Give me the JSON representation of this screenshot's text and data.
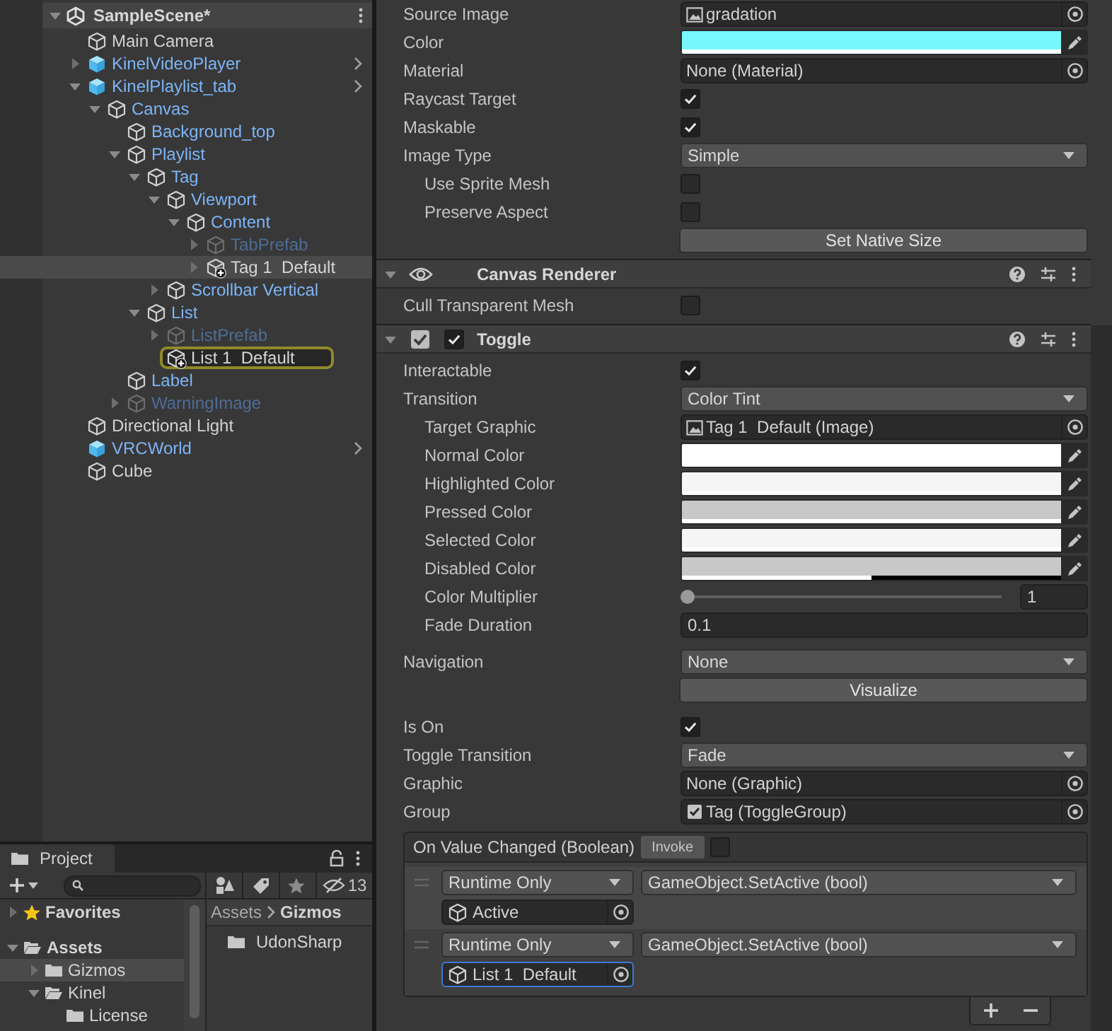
{
  "hierarchy": {
    "tree": [
      {
        "label": "SampleScene*",
        "kind": "scene",
        "expanded": true,
        "children": [
          {
            "label": "Main Camera",
            "kind": "object",
            "selected": false,
            "pinged": false
          },
          {
            "label": "KinelVideoPlayer",
            "kind": "prefab_root",
            "expanded": false,
            "selected": false,
            "pinged": false
          },
          {
            "label": "KinelPlaylist_tab",
            "kind": "prefab_root",
            "expanded": true,
            "selected": false,
            "pinged": false,
            "children": [
              {
                "label": "Canvas",
                "kind": "prefab_child",
                "expanded": true,
                "selected": false,
                "pinged": false,
                "children": [
                  {
                    "label": "Background_top",
                    "kind": "prefab_child",
                    "selected": false,
                    "pinged": false
                  },
                  {
                    "label": "Playlist",
                    "kind": "prefab_child",
                    "expanded": true,
                    "selected": false,
                    "pinged": false,
                    "children": [
                      {
                        "label": "Tag",
                        "kind": "prefab_child",
                        "expanded": true,
                        "selected": false,
                        "pinged": false,
                        "children": [
                          {
                            "label": "Viewport",
                            "kind": "prefab_child",
                            "expanded": true,
                            "selected": false,
                            "pinged": false,
                            "children": [
                              {
                                "label": "Content",
                                "kind": "prefab_child",
                                "expanded": true,
                                "selected": false,
                                "pinged": false,
                                "children": [
                                  {
                                    "label": "TabPrefab",
                                    "kind": "inactive",
                                    "expanded": false,
                                    "selected": false,
                                    "pinged": false
                                  },
                                  {
                                    "label": "Tag 1  Default",
                                    "kind": "added",
                                    "expanded": false,
                                    "selected": true,
                                    "pinged": false
                                  }
                                ]
                              }
                            ]
                          },
                          {
                            "label": "Scrollbar Vertical",
                            "kind": "prefab_child",
                            "expanded": false,
                            "selected": false,
                            "pinged": false
                          }
                        ]
                      },
                      {
                        "label": "List",
                        "kind": "prefab_child",
                        "expanded": true,
                        "selected": false,
                        "pinged": false,
                        "children": [
                          {
                            "label": "ListPrefab",
                            "kind": "inactive",
                            "expanded": false,
                            "selected": false,
                            "pinged": false
                          },
                          {
                            "label": "List 1  Default",
                            "kind": "added",
                            "selected": false,
                            "pinged": true
                          }
                        ]
                      }
                    ]
                  },
                  {
                    "label": "Label",
                    "kind": "prefab_child",
                    "selected": false,
                    "pinged": false
                  },
                  {
                    "label": "WarningImage",
                    "kind": "inactive",
                    "expanded": false,
                    "selected": false,
                    "pinged": false
                  }
                ]
              }
            ]
          },
          {
            "label": "Directional Light",
            "kind": "object",
            "selected": false,
            "pinged": false
          },
          {
            "label": "VRCWorld",
            "kind": "prefab_root",
            "selected": false,
            "pinged": false
          },
          {
            "label": "Cube",
            "kind": "object",
            "selected": false,
            "pinged": false
          }
        ]
      }
    ]
  },
  "project": {
    "tab": "Project",
    "hidden_count": "13",
    "tree": [
      {
        "label": "Favorites",
        "kind": "favorites",
        "expanded": false,
        "selected": false
      },
      {
        "label": "Assets",
        "kind": "root",
        "expanded": true,
        "selected": false,
        "children": [
          {
            "label": "Gizmos",
            "kind": "folder",
            "expanded": false,
            "selected": true
          },
          {
            "label": "Kinel",
            "kind": "folder",
            "expanded": true,
            "selected": false,
            "children": [
              {
                "label": "License",
                "kind": "folder",
                "selected": false
              }
            ]
          }
        ]
      }
    ],
    "breadcrumb": [
      "Assets",
      "Gizmos"
    ],
    "items": [
      {
        "label": "UdonSharp"
      }
    ]
  },
  "inspector": {
    "sections": [
      {
        "groups": [
          [
            {
              "kind": "sprite_ref",
              "label": "Source Image",
              "value": "gradation",
              "indent": false
            },
            {
              "kind": "color",
              "label": "Color",
              "color": "#78f7fc",
              "level": 1,
              "indent": false
            },
            {
              "kind": "empty_ref",
              "label": "Material",
              "value": "None (Material)",
              "indent": false
            },
            {
              "kind": "checkbox",
              "label": "Raycast Target",
              "checked": true,
              "indent": false
            },
            {
              "kind": "checkbox",
              "label": "Maskable",
              "checked": true,
              "indent": false
            },
            {
              "kind": "dropdown",
              "label": "Image Type",
              "value": "Simple",
              "indent": false
            },
            {
              "kind": "checkbox",
              "label": "Use Sprite Mesh",
              "checked": false,
              "indent": true
            },
            {
              "kind": "checkbox",
              "label": "Preserve Aspect",
              "checked": false,
              "indent": true
            },
            {
              "kind": "button",
              "value": "Set Native Size"
            }
          ]
        ]
      },
      {
        "header": {
          "title": "Canvas Renderer",
          "kind": "renderer",
          "expanded": true
        },
        "groups": [
          [
            {
              "kind": "checkbox",
              "label": "Cull Transparent Mesh",
              "checked": false,
              "indent": false
            }
          ]
        ]
      },
      {
        "header": {
          "title": "Toggle",
          "kind": "toggle",
          "expanded": true,
          "enabled": true
        },
        "groups": [
          [
            {
              "kind": "checkbox",
              "label": "Interactable",
              "checked": true,
              "indent": false
            },
            {
              "kind": "dropdown",
              "label": "Transition",
              "value": "Color Tint",
              "indent": false
            },
            {
              "kind": "image_ref",
              "label": "Target Graphic",
              "value": "Tag 1  Default (Image)",
              "indent": true
            },
            {
              "kind": "color",
              "label": "Normal Color",
              "color": "#ffffff",
              "level": 1,
              "indent": true
            },
            {
              "kind": "color",
              "label": "Highlighted Color",
              "color": "#f5f5f5",
              "level": 1,
              "indent": true
            },
            {
              "kind": "color",
              "label": "Pressed Color",
              "color": "#c8c8c8",
              "level": 1,
              "indent": true
            },
            {
              "kind": "color",
              "label": "Selected Color",
              "color": "#f5f5f5",
              "level": 1,
              "indent": true
            },
            {
              "kind": "color",
              "label": "Disabled Color",
              "color": "#c8c8c8",
              "level": 0.5,
              "indent": true
            },
            {
              "kind": "slider",
              "label": "Color Multiplier",
              "level": 0,
              "reading": "1",
              "indent": true
            },
            {
              "kind": "number",
              "label": "Fade Duration",
              "value": "0.1",
              "indent": true
            }
          ],
          [
            {
              "kind": "dropdown",
              "label": "Navigation",
              "value": "None",
              "indent": false
            },
            {
              "kind": "button",
              "value": "Visualize"
            }
          ],
          [
            {
              "kind": "checkbox",
              "label": "Is On",
              "checked": true,
              "indent": false
            },
            {
              "kind": "dropdown",
              "label": "Toggle Transition",
              "value": "Fade",
              "indent": false
            },
            {
              "kind": "empty_ref",
              "label": "Graphic",
              "value": "None (Graphic)",
              "indent": false
            },
            {
              "kind": "group_ref",
              "label": "Group",
              "value": "Tag (ToggleGroup)",
              "indent": false
            }
          ]
        ],
        "event": {
          "title": "On Value Changed (Boolean)",
          "invoke": "Invoke",
          "checked": false,
          "entries": [
            {
              "mode": "Runtime Only",
              "function": "GameObject.SetActive (bool)",
              "target": "Active",
              "selected": true,
              "focused": false
            },
            {
              "mode": "Runtime Only",
              "function": "GameObject.SetActive (bool)",
              "target": "List 1  Default",
              "selected": false,
              "focused": true
            }
          ]
        }
      }
    ]
  }
}
